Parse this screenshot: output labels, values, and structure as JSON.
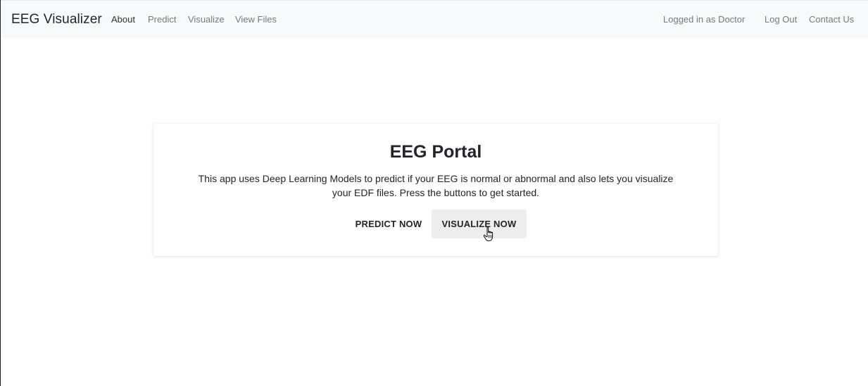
{
  "navbar": {
    "brand": "EEG Visualizer",
    "left_links": [
      "About",
      "Predict",
      "Visualize",
      "View Files"
    ],
    "user_status": "Logged in as Doctor",
    "logout": "Log Out",
    "contact": "Contact Us"
  },
  "hero": {
    "title": "EEG Portal",
    "line1": "This app uses Deep Learning Models to predict if your EEG is normal or abnormal and also lets you visualize",
    "line2": "your EDF files. Press the buttons to get started.",
    "predict_button": "PREDICT NOW",
    "visualize_button": "VISUALIZE NOW"
  },
  "icons": {
    "cursor": "hand-pointer-icon"
  }
}
